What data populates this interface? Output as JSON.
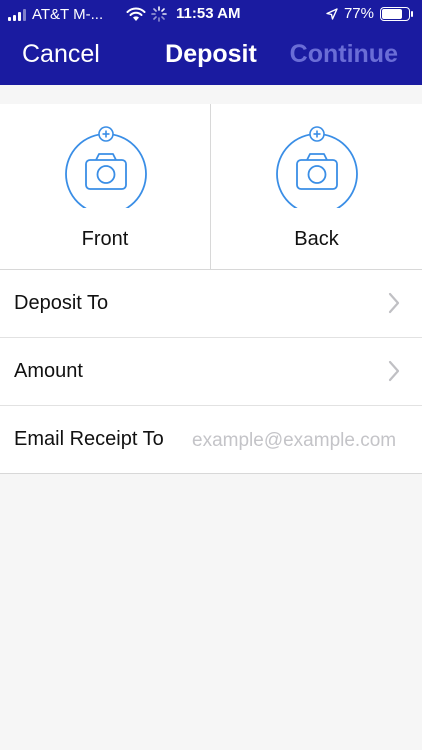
{
  "status_bar": {
    "carrier": "AT&T M-...",
    "time": "11:53 AM",
    "battery": "77%",
    "battery_level": 0.77
  },
  "nav": {
    "cancel": "Cancel",
    "title": "Deposit",
    "continue": "Continue"
  },
  "photos": {
    "front_label": "Front",
    "back_label": "Back"
  },
  "form": {
    "deposit_to_label": "Deposit To",
    "amount_label": "Amount",
    "email_label": "Email Receipt To",
    "email_placeholder": "example@example.com",
    "email_value": ""
  },
  "colors": {
    "header": "#1a1ba0",
    "accent": "#3a8ee6",
    "continue_disabled": "#6a6dd6",
    "background": "#f6f6f6"
  },
  "icons": [
    "signal-icon",
    "wifi-icon",
    "activity-icon",
    "location-icon",
    "battery-icon",
    "camera-icon",
    "add-icon",
    "chevron-right-icon"
  ]
}
